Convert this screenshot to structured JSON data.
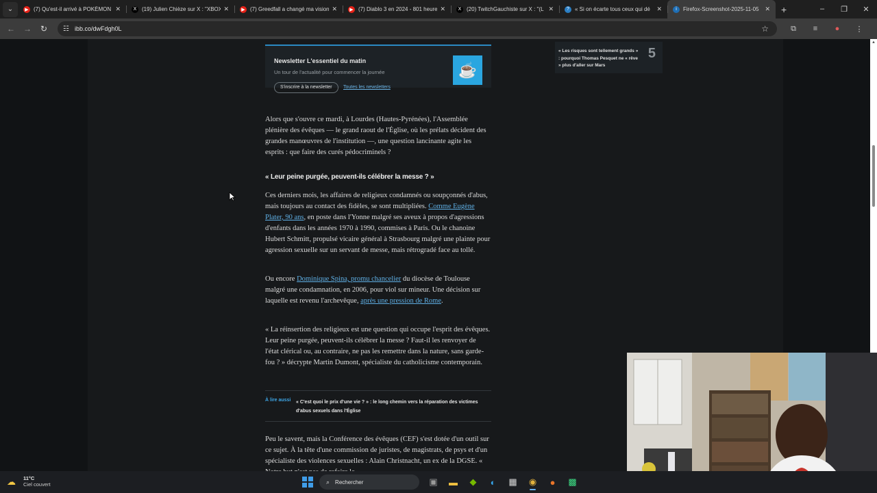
{
  "tabs": [
    {
      "title": "(7) Qu'est-il arrivé à POKÉMON",
      "icon": "youtube-icon",
      "color": "#e62117"
    },
    {
      "title": "(19) Julien Chièze sur X : \"XBOX",
      "icon": "x-icon",
      "color": "#000000"
    },
    {
      "title": "(7) Greedfall a changé ma vision",
      "icon": "youtube-icon",
      "color": "#e62117"
    },
    {
      "title": "(7) Diablo 3 en 2024 - 801 heures",
      "icon": "youtube-icon",
      "color": "#e62117"
    },
    {
      "title": "(20) TwitchGauchiste sur X : \"(L",
      "icon": "x-icon",
      "color": "#000000"
    },
    {
      "title": "« Si on écarte tous ceux qui dé",
      "icon": "lemonde-icon",
      "color": "#2b7fc4"
    },
    {
      "title": "Firefox-Screenshot-2025-11-05",
      "icon": "imgbb-icon",
      "color": "#1f6fb5"
    }
  ],
  "address": {
    "url": "ibb.co/dwFdgh0L"
  },
  "newsletter": {
    "title": "Newsletter L'essentiel du matin",
    "subtitle": "Un tour de l'actualité pour commencer la journée",
    "subscribe": "S'inscrire à la newsletter",
    "all": "Toutes les newsletters"
  },
  "sidebar_card": {
    "text": "« Les risques sont tellement grands » : pourquoi Thomas Pesquet ne « rêve » plus d'aller sur Mars",
    "rank": "5"
  },
  "article": {
    "intro": "Alors que s'ouvre ce mardi, à Lourdes (Hautes-Pyrénées), l'Assemblée plénière des évêques — le grand raout de l'Église, où les prélats décident des grandes manœuvres de l'institution —, une question lancinante agite les esprits : que faire des curés pédocriminels ?",
    "heading": "« Leur peine purgée, peuvent-ils célébrer la messe ? »",
    "p1_a": "Ces derniers mois, les affaires de religieux condamnés ou soupçonnés d'abus, mais toujours au contact des fidèles, se sont multipliées. ",
    "p1_link": "Comme Eugène Plater, 90 ans",
    "p1_b": ", en poste dans l'Yonne malgré ses aveux à propos d'agressions d'enfants dans les années 1970 à 1990, commises à Paris. Ou le chanoine Hubert Schmitt, propulsé vicaire général à Strasbourg malgré une plainte pour agression sexuelle sur un servant de messe, mais rétrogradé face au tollé.",
    "p2_a": "Ou encore ",
    "p2_link1": "Dominique Spina, promu chancelier",
    "p2_b": " du diocèse de Toulouse malgré une condamnation, en 2006, pour viol sur mineur. Une décision sur laquelle est revenu l'archevêque, ",
    "p2_link2": "après une pression de Rome",
    "p2_c": ".",
    "p3": "« La réinsertion des religieux est une question qui occupe l'esprit des évêques. Leur peine purgée, peuvent-ils célébrer la messe ? Faut-il les renvoyer de l'état clérical ou, au contraire, ne pas les remettre dans la nature, sans garde-fou ? » décrypte Martin Dumont, spécialiste du catholicisme contemporain.",
    "read_also_label": "À lire aussi",
    "read_also_text": "« C'est quoi le prix d'une vie ? » : le long chemin vers la réparation des victimes d'abus sexuels dans l'Église",
    "p4": "Peu le savent, mais la Conférence des évêques (CEF) s'est dotée d'un outil sur ce sujet. À la tête d'une commission de juristes, de magistrats, de psys et d'un spécialiste des violences sexuelles : Alain Christnacht, un ex de la DGSE. « Notre but n'est pas de refaire le"
  },
  "taskbar": {
    "temp": "11°C",
    "weather": "Ciel couvert",
    "search_placeholder": "Rechercher"
  }
}
